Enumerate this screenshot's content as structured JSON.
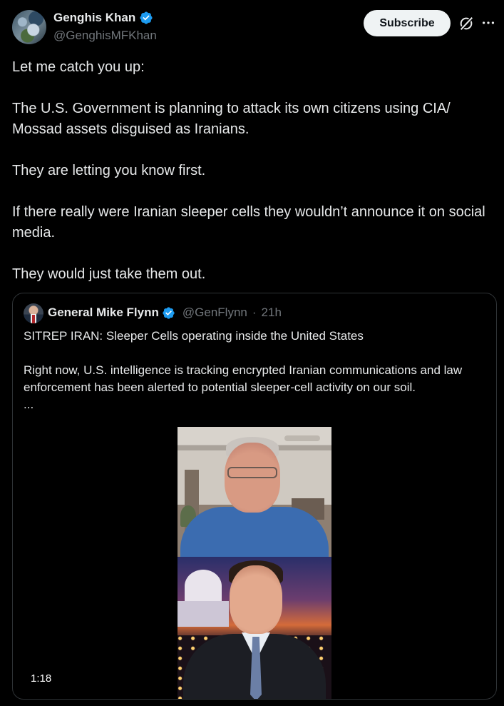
{
  "author": {
    "name": "Genghis Khan",
    "handle": "@GenghisMFKhan"
  },
  "subscribe_label": "Subscribe",
  "tweet": {
    "lines": [
      "Let me catch you up:",
      "The U.S. Government is planning to attack its own citizens using CIA/ Mossad assets disguised as Iranians.",
      "They are letting you know first.",
      "If there really were Iranian sleeper cells they wouldn’t announce it on social media.",
      "They would just take them out."
    ]
  },
  "quote": {
    "name": "General Mike Flynn",
    "handle": "@GenFlynn",
    "separator": "·",
    "time": "21h",
    "text1": "SITREP IRAN: Sleeper Cells operating inside the United States",
    "text2": "Right now, U.S. intelligence is tracking encrypted Iranian communications and law enforcement has been alerted to potential sleeper-cell activity on our soil.",
    "ellipsis": "...",
    "video_duration": "1:18"
  },
  "colors": {
    "background": "#000000",
    "text": "#e7e9ea",
    "muted": "#71767b",
    "verified": "#1d9bf0",
    "border": "#2f3336"
  },
  "icons": [
    "verified-badge-icon",
    "grok-icon",
    "more-icon"
  ]
}
